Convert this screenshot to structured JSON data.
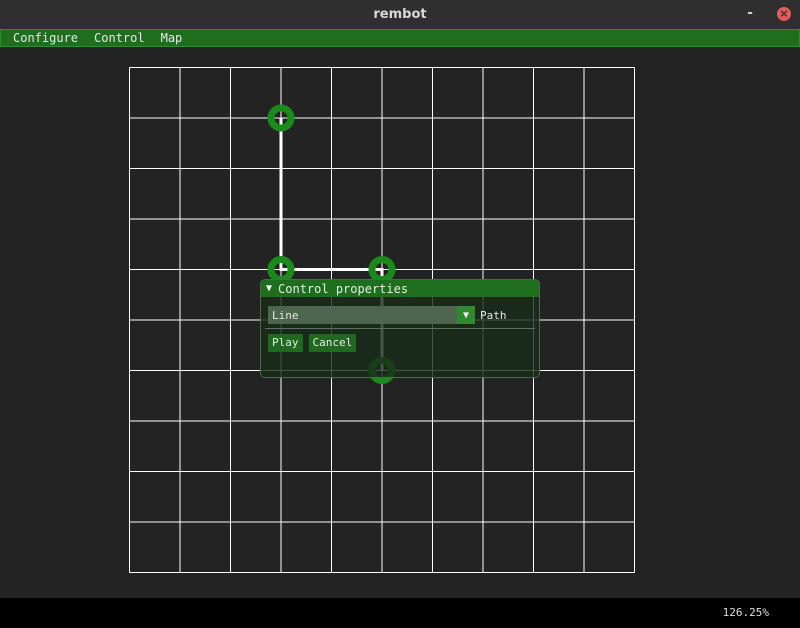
{
  "window": {
    "title": "rembot",
    "minimize_label": "-",
    "close_label": "×"
  },
  "menu": {
    "items": [
      "Configure",
      "Control",
      "Map"
    ]
  },
  "map": {
    "grid_columns": 10,
    "grid_rows": 10,
    "path_color": "#ffffff",
    "node_color": "#1a8a1a",
    "grid_color": "#ffffff",
    "background_color": "#232323",
    "nodes": [
      {
        "col": 3,
        "row": 1
      },
      {
        "col": 3,
        "row": 4
      },
      {
        "col": 5,
        "row": 4
      },
      {
        "col": 5,
        "row": 6
      }
    ]
  },
  "control_panel": {
    "collapse_icon": "triangle-down-icon",
    "title": "Control properties",
    "select_value": "Line",
    "select_label": "Path",
    "play_label": "Play",
    "cancel_label": "Cancel"
  },
  "status": {
    "zoom": "126.25%"
  },
  "colors": {
    "accent_green": "#1e6e1e",
    "close_red": "#e25a5a",
    "status_bg": "#000000"
  }
}
